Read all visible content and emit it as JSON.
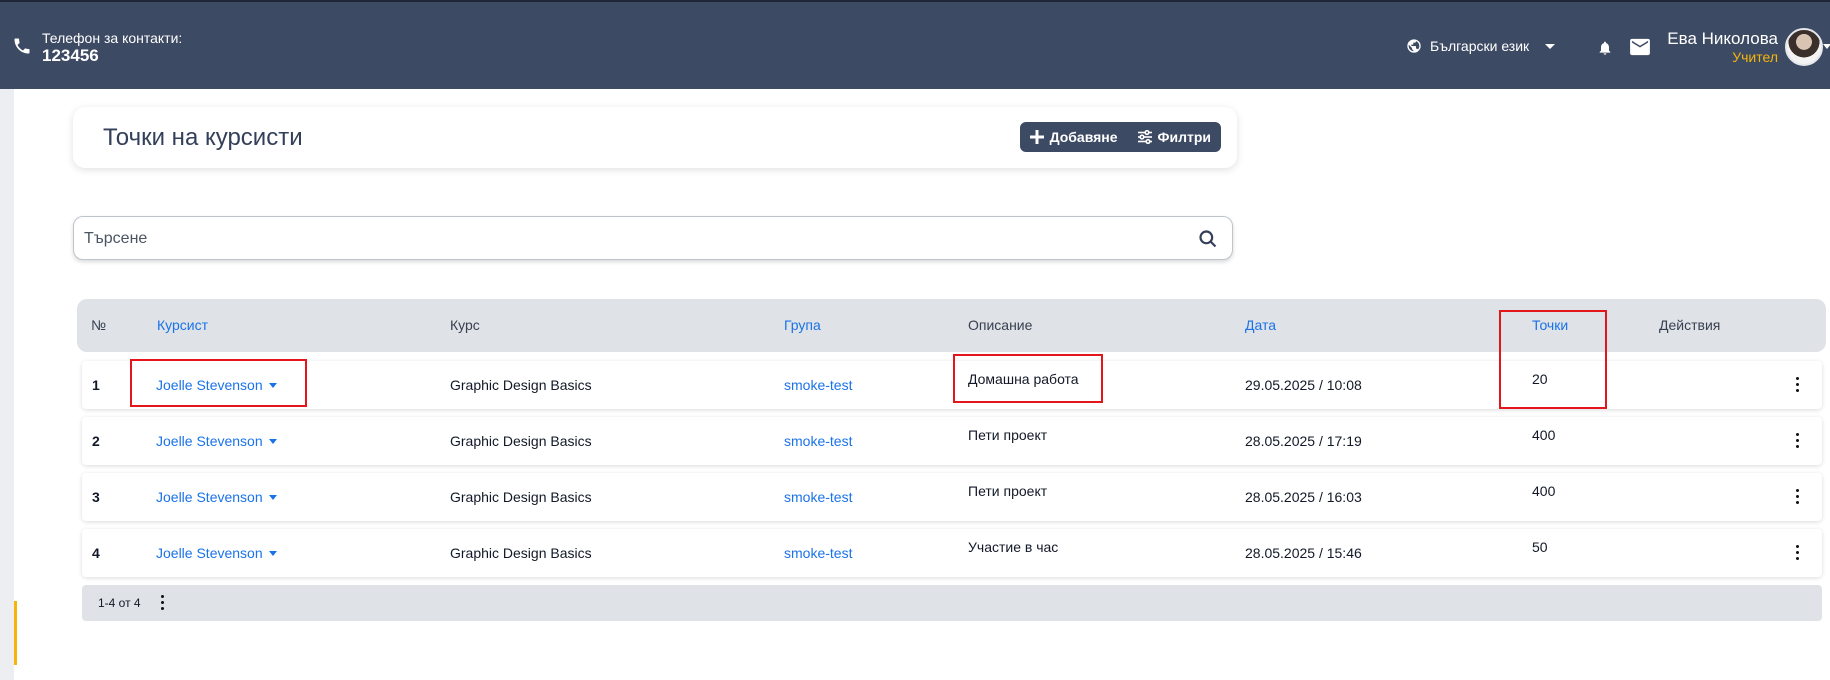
{
  "header": {
    "phone_label": "Телефон за контакти:",
    "phone_number": "123456",
    "language": "Български език",
    "user_name": "Ева Николова",
    "user_role": "Учител"
  },
  "page": {
    "title": "Точки на курсисти",
    "add_label": "Добавяне",
    "filters_label": "Филтри",
    "search_placeholder": "Търсене"
  },
  "table": {
    "headers": {
      "num": "№",
      "student": "Курсист",
      "course": "Курс",
      "group": "Група",
      "description": "Описание",
      "date": "Дата",
      "points": "Точки",
      "actions": "Действия"
    },
    "rows": [
      {
        "num": "1",
        "student": "Joelle Stevenson",
        "course": "Graphic Design Basics",
        "group": "smoke-test",
        "description": "Домашна работа",
        "date": "29.05.2025 / 10:08",
        "points": "20"
      },
      {
        "num": "2",
        "student": "Joelle Stevenson",
        "course": "Graphic Design Basics",
        "group": "smoke-test",
        "description": "Пети проект",
        "date": "28.05.2025 / 17:19",
        "points": "400"
      },
      {
        "num": "3",
        "student": "Joelle Stevenson",
        "course": "Graphic Design Basics",
        "group": "smoke-test",
        "description": "Пети проект",
        "date": "28.05.2025 / 16:03",
        "points": "400"
      },
      {
        "num": "4",
        "student": "Joelle Stevenson",
        "course": "Graphic Design Basics",
        "group": "smoke-test",
        "description": "Участие в час",
        "date": "28.05.2025 / 15:46",
        "points": "50"
      }
    ],
    "pagination": "1-4 от 4"
  },
  "colors": {
    "header_bg": "#3d4a63",
    "link": "#1a73e8",
    "role": "#f5b50a",
    "highlight": "#e3161b"
  }
}
